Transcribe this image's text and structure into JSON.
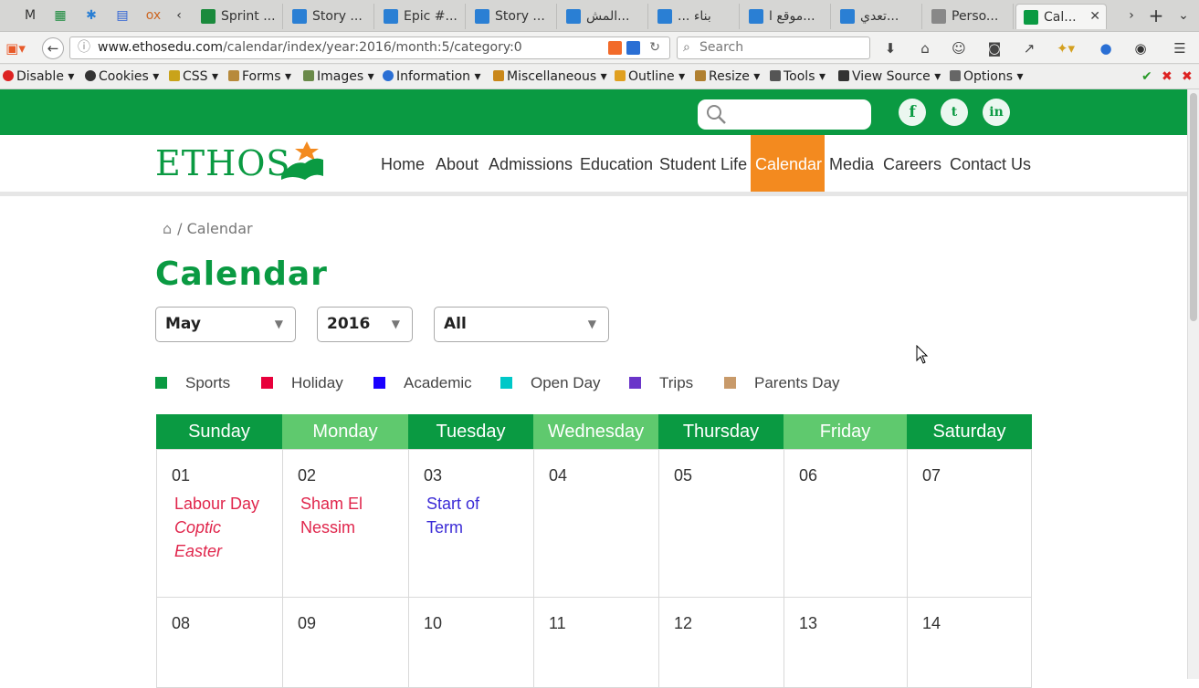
{
  "browser": {
    "tabs": [
      {
        "label": "",
        "icon": "gmail-icon"
      },
      {
        "label": "",
        "icon": "sheets-icon"
      },
      {
        "label": "",
        "icon": "jira-icon"
      },
      {
        "label": "",
        "icon": "docs-icon"
      },
      {
        "label": "",
        "icon": "odoo-icon"
      },
      {
        "label": "Sprint ...",
        "icon": "sheets-icon"
      },
      {
        "label": "Story ...",
        "icon": "jira-icon"
      },
      {
        "label": "Epic #...",
        "icon": "jira-icon"
      },
      {
        "label": "Story ...",
        "icon": "jira-icon"
      },
      {
        "label": "المش...",
        "icon": "site-icon"
      },
      {
        "label": "... بناء",
        "icon": "site-icon"
      },
      {
        "label": "موقع ا...",
        "icon": "site-icon"
      },
      {
        "label": "تعدي...",
        "icon": "site-icon"
      },
      {
        "label": "Perso...",
        "icon": "gmail-icon"
      },
      {
        "label": "Cal...",
        "icon": "ethos-icon"
      }
    ],
    "url_host": "www.ethosedu.com",
    "url_path": "/calendar/index/year:2016/month:5/category:0",
    "search_placeholder": "Search"
  },
  "devbar": {
    "items": [
      "Disable",
      "Cookies",
      "CSS",
      "Forms",
      "Images",
      "Information",
      "Miscellaneous",
      "Outline",
      "Resize",
      "Tools",
      "View Source",
      "Options"
    ]
  },
  "site": {
    "logo": "ETHOS",
    "social": [
      "f",
      "t",
      "in"
    ],
    "menu": [
      "Home",
      "About",
      "Admissions",
      "Education",
      "Student Life",
      "Calendar",
      "Media",
      "Careers",
      "Contact Us"
    ],
    "active_menu": "Calendar",
    "breadcrumb": "/ Calendar",
    "title": "Calendar",
    "filters": {
      "month": "May",
      "year": "2016",
      "category": "All"
    },
    "legend": [
      {
        "label": "Sports",
        "color": "#0a9a42"
      },
      {
        "label": "Holiday",
        "color": "#e8003b"
      },
      {
        "label": "Academic",
        "color": "#1a00ff"
      },
      {
        "label": "Open Day",
        "color": "#00c8c8"
      },
      {
        "label": "Trips",
        "color": "#6a35c9"
      },
      {
        "label": "Parents Day",
        "color": "#c89a6a"
      }
    ],
    "weekdays": [
      "Sunday",
      "Monday",
      "Tuesday",
      "Wednesday",
      "Thursday",
      "Friday",
      "Saturday"
    ],
    "week1": [
      {
        "day": "01",
        "events": [
          {
            "text": "Labour Day",
            "color": "#e0264c",
            "italic": false
          },
          {
            "text": "Coptic Easter",
            "color": "#e0264c",
            "italic": true
          }
        ]
      },
      {
        "day": "02",
        "events": [
          {
            "text": "Sham El Nessim",
            "color": "#e0264c",
            "italic": false
          }
        ]
      },
      {
        "day": "03",
        "events": [
          {
            "text": "Start of Term",
            "color": "#3b2bd6",
            "italic": false
          }
        ]
      },
      {
        "day": "04",
        "events": []
      },
      {
        "day": "05",
        "events": []
      },
      {
        "day": "06",
        "events": []
      },
      {
        "day": "07",
        "events": []
      }
    ],
    "week2": [
      "08",
      "09",
      "10",
      "11",
      "12",
      "13",
      "14"
    ]
  }
}
